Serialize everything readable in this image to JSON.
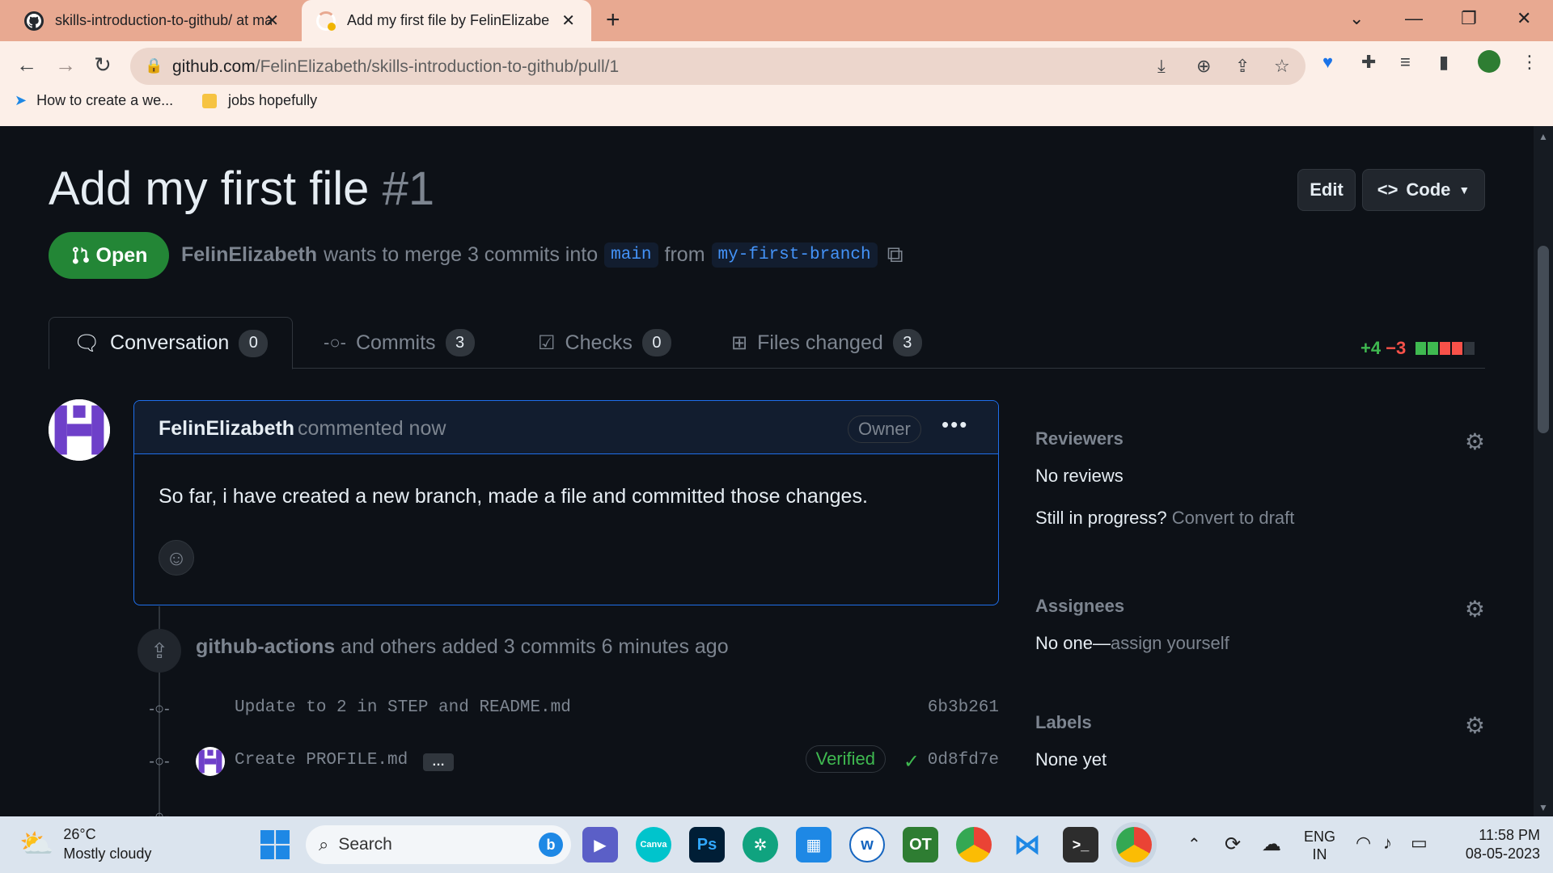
{
  "browser": {
    "tabs": [
      {
        "title": "skills-introduction-to-github/ at ma",
        "close": "✕"
      },
      {
        "title": "Add my first file by FelinElizabeth",
        "close": "✕"
      }
    ],
    "new_tab": "+",
    "url_host": "github.com",
    "url_path": "/FelinElizabeth/skills-introduction-to-github/pull/1",
    "bookmarks": [
      "How to create a we...",
      "jobs hopefully"
    ]
  },
  "pr": {
    "title": "Add my first file",
    "number": "#1",
    "edit_label": "Edit",
    "code_label": "Code",
    "state": "Open",
    "author": "FelinElizabeth",
    "merge_text": "wants to merge 3 commits into",
    "base": "main",
    "from_text": "from",
    "head": "my-first-branch",
    "tabs": [
      {
        "label": "Conversation",
        "count": "0"
      },
      {
        "label": "Commits",
        "count": "3"
      },
      {
        "label": "Checks",
        "count": "0"
      },
      {
        "label": "Files changed",
        "count": "3"
      }
    ],
    "additions": "+4",
    "deletions": "−3",
    "colors": {
      "add": "#3fb950",
      "del": "#f85149",
      "neutral": "#30363d"
    }
  },
  "comment": {
    "author": "FelinElizabeth",
    "when": "commented now",
    "role": "Owner",
    "body": "So far, i have created a new branch, made a file and committed those changes."
  },
  "timeline": {
    "actor": "github-actions",
    "text": "and others added 3 commits 6 minutes ago",
    "commits": [
      {
        "message": "Update to 2 in STEP and README.md",
        "sha": "6b3b261"
      },
      {
        "message": "Create PROFILE.md",
        "more": "…",
        "verified": "Verified",
        "sha": "0d8fd7e"
      }
    ]
  },
  "sidebar": {
    "reviewers": {
      "heading": "Reviewers",
      "value": "No reviews",
      "progress_q": "Still in progress?",
      "progress_link": "Convert to draft"
    },
    "assignees": {
      "heading": "Assignees",
      "value": "No one—",
      "link": "assign yourself"
    },
    "labels": {
      "heading": "Labels",
      "value": "None yet"
    }
  },
  "taskbar": {
    "temp": "26°C",
    "weather": "Mostly cloudy",
    "search": "Search",
    "lang": "ENG",
    "region": "IN",
    "time": "11:58 PM",
    "date": "08-05-2023"
  }
}
